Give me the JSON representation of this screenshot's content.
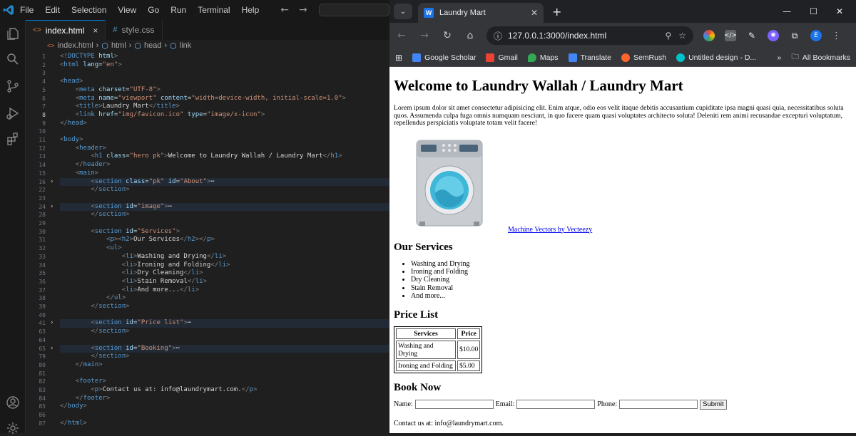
{
  "vscode": {
    "menu": [
      "File",
      "Edit",
      "Selection",
      "View",
      "Go",
      "Run",
      "Terminal",
      "Help"
    ],
    "tabs": [
      {
        "label": "index.html",
        "icon": "html-file-icon",
        "close": "×"
      },
      {
        "label": "style.css",
        "icon": "css-file-icon"
      }
    ],
    "breadcrumb": [
      "index.html",
      "html",
      "head",
      "link"
    ],
    "lines": [
      {
        "n": "1",
        "code": "<!DOCTYPE html>"
      },
      {
        "n": "2",
        "code": "<html lang=\"en\">"
      },
      {
        "n": "3",
        "code": ""
      },
      {
        "n": "4",
        "code": "<head>"
      },
      {
        "n": "5",
        "code": "    <meta charset=\"UTF-8\">"
      },
      {
        "n": "6",
        "code": "    <meta name=\"viewport\" content=\"width=device-width, initial-scale=1.0\">"
      },
      {
        "n": "7",
        "code": "    <title>Laundry Mart</title>"
      },
      {
        "n": "8",
        "code": "    <link href=\"img/favicon.ico\" type=\"image/x-icon\">"
      },
      {
        "n": "9",
        "code": "</head>"
      },
      {
        "n": "10",
        "code": ""
      },
      {
        "n": "11",
        "code": "<body>"
      },
      {
        "n": "12",
        "code": "    <header>"
      },
      {
        "n": "13",
        "code": "        <h1 class=\"hero pk\">Welcome to Laundry Wallah / Laundry Mart</h1>"
      },
      {
        "n": "14",
        "code": "    </header>"
      },
      {
        "n": "15",
        "code": "    <main>"
      },
      {
        "n": "16",
        "code": "        <section class=\"pk\" id=\"About\">⋯"
      },
      {
        "n": "22",
        "code": "        </section>"
      },
      {
        "n": "23",
        "code": ""
      },
      {
        "n": "24",
        "code": "        <section id=\"image\">⋯"
      },
      {
        "n": "28",
        "code": "        </section>"
      },
      {
        "n": "29",
        "code": ""
      },
      {
        "n": "30",
        "code": "        <section id=\"Services\">"
      },
      {
        "n": "31",
        "code": "            <p><h2>Our Services</h2></p>"
      },
      {
        "n": "32",
        "code": "            <ul>"
      },
      {
        "n": "33",
        "code": "                <li>Washing and Drying</li>"
      },
      {
        "n": "34",
        "code": "                <li>Ironing and Folding</li>"
      },
      {
        "n": "35",
        "code": "                <li>Dry Cleaning</li>"
      },
      {
        "n": "36",
        "code": "                <li>Stain Removal</li>"
      },
      {
        "n": "37",
        "code": "                <li>And more...</li>"
      },
      {
        "n": "38",
        "code": "            </ul>"
      },
      {
        "n": "39",
        "code": "        </section>"
      },
      {
        "n": "40",
        "code": ""
      },
      {
        "n": "41",
        "code": "        <section id=\"Price list\">⋯"
      },
      {
        "n": "63",
        "code": "        </section>"
      },
      {
        "n": "64",
        "code": ""
      },
      {
        "n": "65",
        "code": "        <section id=\"Booking\">⋯"
      },
      {
        "n": "79",
        "code": "        </section>"
      },
      {
        "n": "80",
        "code": "    </main>"
      },
      {
        "n": "81",
        "code": ""
      },
      {
        "n": "82",
        "code": "    <footer>"
      },
      {
        "n": "83",
        "code": "        <p>Contact us at: info@laundrymart.com.</p>"
      },
      {
        "n": "84",
        "code": "    </footer>"
      },
      {
        "n": "85",
        "code": "</body>"
      },
      {
        "n": "86",
        "code": ""
      },
      {
        "n": "87",
        "code": "</html>"
      }
    ]
  },
  "browser": {
    "tab_title": "Laundry Mart",
    "favicon_letter": "W",
    "url": "127.0.0.1:3000/index.html",
    "bookmarks": [
      {
        "label": "Google Scholar",
        "color": "#4285f4"
      },
      {
        "label": "Gmail",
        "color": "#ea4335"
      },
      {
        "label": "Maps",
        "color": "#34a853"
      },
      {
        "label": "Translate",
        "color": "#4285f4"
      },
      {
        "label": "SemRush",
        "color": "#ff642d"
      },
      {
        "label": "Untitled design - D...",
        "color": "#00c4cc"
      }
    ],
    "all_bookmarks": "All Bookmarks",
    "profile_letter": "E"
  },
  "page": {
    "heading": "Welcome to Laundry Wallah / Laundry Mart",
    "lorem": "Lorem ipsum dolor sit amet consectetur adipisicing elit. Enim atque, odio eos velit itaque debitis accusantium cupiditate ipsa magni quasi quia, necessitatibus soluta quos. Assumenda culpa fuga omnis numquam nesciunt, in quo facere quam quasi voluptates architecto soluta! Deleniti rem animi recusandae excepturi voluptatum, repellendus perspiciatis voluptate totam velit facere!",
    "image_credit": "Machine Vectors by Vecteezy",
    "services_title": "Our Services",
    "services": [
      "Washing and Drying",
      "Ironing and Folding",
      "Dry Cleaning",
      "Stain Removal",
      "And more..."
    ],
    "price_title": "Price List",
    "price_headers": [
      "Services",
      "Price"
    ],
    "price_rows": [
      [
        "Washing and Drying",
        "$10.00"
      ],
      [
        "Ironing and Folding",
        "$5.00"
      ]
    ],
    "booking_title": "Book Now",
    "form": {
      "name_label": "Name:",
      "email_label": "Email:",
      "phone_label": "Phone:",
      "submit": "Submit"
    },
    "footer": "Contact us at: info@laundrymart.com."
  }
}
